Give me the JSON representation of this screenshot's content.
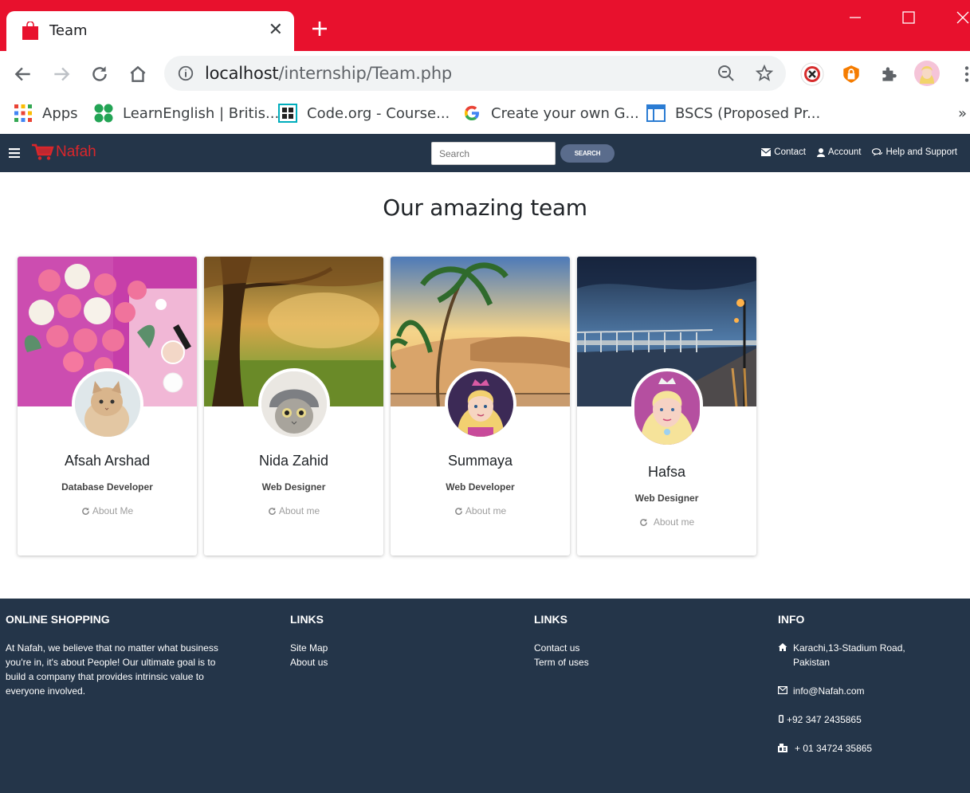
{
  "browser": {
    "tab_title": "Team",
    "url_host": "localhost",
    "url_path": "/internship/Team.php",
    "bookmarks": [
      {
        "label": "Apps",
        "icon": "apps-grid-icon"
      },
      {
        "label": "LearnEnglish | Britis...",
        "icon": "learnenglish-icon"
      },
      {
        "label": "Code.org - Course...",
        "icon": "codeorg-icon"
      },
      {
        "label": "Create your own G...",
        "icon": "google-icon"
      },
      {
        "label": "BSCS (Proposed Pr...",
        "icon": "doc-icon"
      }
    ],
    "more_bookmarks": "»"
  },
  "navbar": {
    "logo_text": "Nafah",
    "search_placeholder": "Search",
    "search_button": "SEARCH",
    "links": {
      "contact": "Contact",
      "account": "Account",
      "help": "Help and Support"
    }
  },
  "main": {
    "heading": "Our amazing team",
    "members": [
      {
        "name": "Afsah Arshad",
        "role": "Database Developer",
        "about": "About Me",
        "cover": "flowers"
      },
      {
        "name": "Nida Zahid",
        "role": "Web Designer",
        "about": "About me",
        "cover": "autumn-forest"
      },
      {
        "name": "Summaya",
        "role": "Web Developer",
        "about": "About me",
        "cover": "beach-palms"
      },
      {
        "name": "Hafsa",
        "role": "Web Designer",
        "about": "About me",
        "cover": "pier-night"
      }
    ]
  },
  "footer": {
    "about": {
      "heading": "ONLINE SHOPPING",
      "text": "At Nafah, we believe that no matter what business you're in, it's about People! Our ultimate goal is to build a company that provides intrinsic value to everyone involved."
    },
    "links1": {
      "heading": "LINKS",
      "items": [
        "Site Map",
        "About us"
      ]
    },
    "links2": {
      "heading": "LINKS",
      "items": [
        "Contact us",
        "Term of uses"
      ]
    },
    "info": {
      "heading": "INFO",
      "address": "Karachi,13-Stadium Road, Pakistan",
      "email": "info@Nafah.com",
      "phone": "+92 347 2435865",
      "fax": "+ 01 34724 35865"
    }
  },
  "colors": {
    "chrome_red": "#e8112d",
    "navbar": "#243549",
    "logo_red": "#d9262b",
    "search_btn": "#5a6c8c"
  }
}
